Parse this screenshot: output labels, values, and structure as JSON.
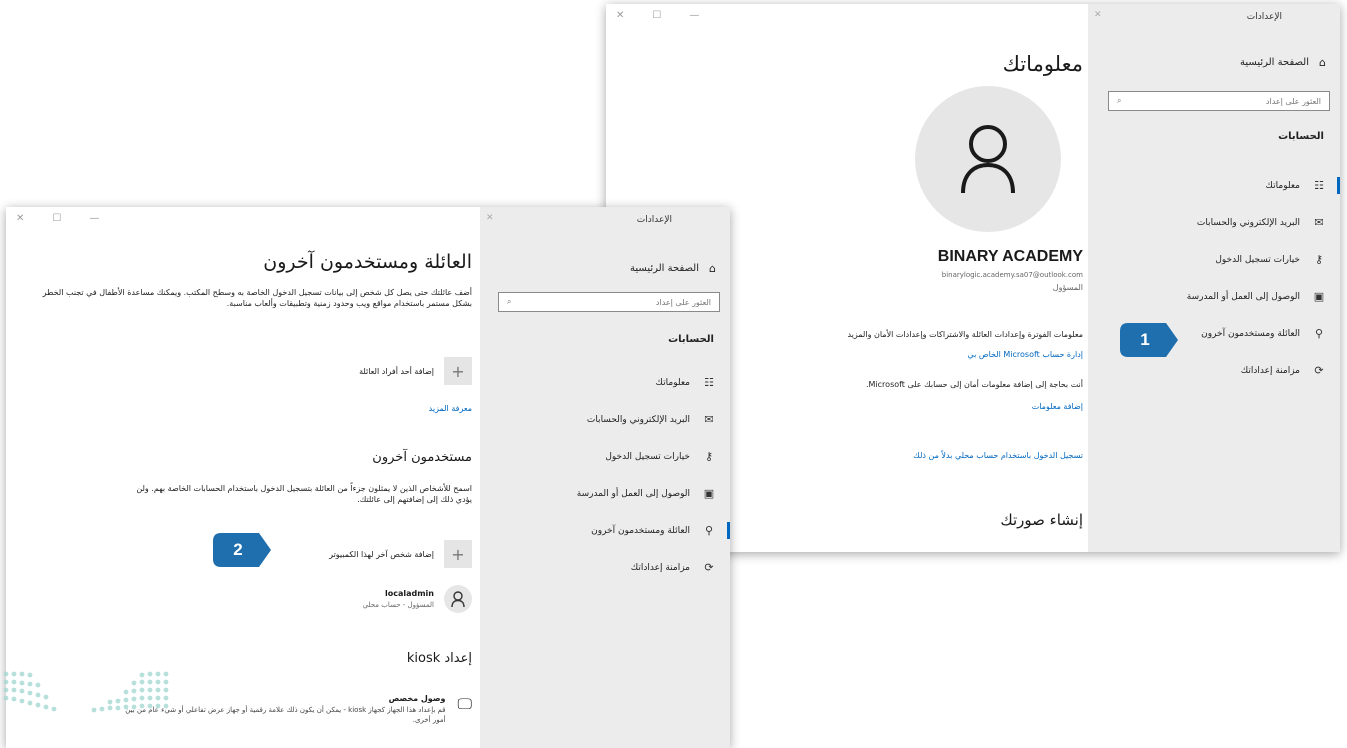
{
  "colors": {
    "accent": "#0067c0",
    "callout": "#1f6fae",
    "sidebar_bg": "#ececec"
  },
  "back_window": {
    "sidebar": {
      "title": "الإعدادات",
      "home": "الصفحة الرئيسية",
      "search_placeholder": "العثور على إعداد",
      "section": "الحسابات",
      "items": [
        {
          "label": "معلوماتك",
          "icon": "user-card-icon"
        },
        {
          "label": "البريد الإلكتروني والحسابات",
          "icon": "mail-icon"
        },
        {
          "label": "خيارات تسجيل الدخول",
          "icon": "key-icon"
        },
        {
          "label": "الوصول إلى العمل أو المدرسة",
          "icon": "briefcase-icon"
        },
        {
          "label": "العائلة ومستخدمون آخرون",
          "icon": "person-icon"
        },
        {
          "label": "مزامنة إعداداتك",
          "icon": "sync-icon"
        }
      ]
    },
    "main": {
      "title": "معلوماتك",
      "user_name": "BINARY ACADEMY",
      "user_email": "binarylogic.academy.sa07@outlook.com",
      "user_role": "المسؤول",
      "billing_text": "معلومات الفوترة وإعدادات العائلة والاشتراكات وإعدادات الأمان والمزيد",
      "manage_link": "إدارة حساب Microsoft الخاص بي",
      "info_text": "أنت بحاجة إلى إضافة معلومات أمان إلى حسابك على Microsoft.",
      "add_info_link": "إضافة معلومات",
      "local_signin_link": "تسجيل الدخول باستخدام حساب محلي بدلاً من ذلك",
      "create_picture": "إنشاء صورتك"
    }
  },
  "front_window": {
    "sidebar": {
      "title": "الإعدادات",
      "home": "الصفحة الرئيسية",
      "search_placeholder": "العثور على إعداد",
      "section": "الحسابات",
      "items": [
        {
          "label": "معلوماتك",
          "icon": "user-card-icon"
        },
        {
          "label": "البريد الإلكتروني والحسابات",
          "icon": "mail-icon"
        },
        {
          "label": "خيارات تسجيل الدخول",
          "icon": "key-icon"
        },
        {
          "label": "الوصول إلى العمل أو المدرسة",
          "icon": "briefcase-icon"
        },
        {
          "label": "العائلة ومستخدمون آخرون",
          "icon": "person-icon"
        },
        {
          "label": "مزامنة إعداداتك",
          "icon": "sync-icon"
        }
      ]
    },
    "main": {
      "title": "العائلة ومستخدمون آخرون",
      "desc": "أضف عائلتك حتى يصل كل شخص إلى بيانات تسجيل الدخول الخاصة به وسطح المكتب. ويمكنك مساعدة الأطفال في تجنب الخطر بشكل مستمر باستخدام مواقع ويب وحدود زمنية وتطبيقات وألعاب مناسبة.",
      "add_family_label": "إضافة أحد أفراد العائلة",
      "learn_more": "معرفة المزيد",
      "other_users_heading": "مستخدمون آخرون",
      "other_users_desc": "اسمح للأشخاص الذين لا يمثلون جزءاً من العائلة بتسجيل الدخول باستخدام الحسابات الخاصة بهم. ولن يؤدي ذلك إلى إضافتهم إلى عائلتك.",
      "add_other_label": "إضافة شخص آخر لهذا الكمبيوتر",
      "user_name": "localadmin",
      "user_sub": "المسؤول - حساب محلي",
      "kiosk_heading": "إعداد kiosk",
      "kiosk_title": "وصول مخصص",
      "kiosk_desc": "قم بإعداد هذا الجهاز كجهاز kiosk - يمكن أن يكون ذلك علامة رقمية أو جهاز عرض تفاعلي أو شيء عام من بين أمور أخرى."
    }
  },
  "callouts": [
    {
      "label": "1"
    },
    {
      "label": "2"
    }
  ]
}
